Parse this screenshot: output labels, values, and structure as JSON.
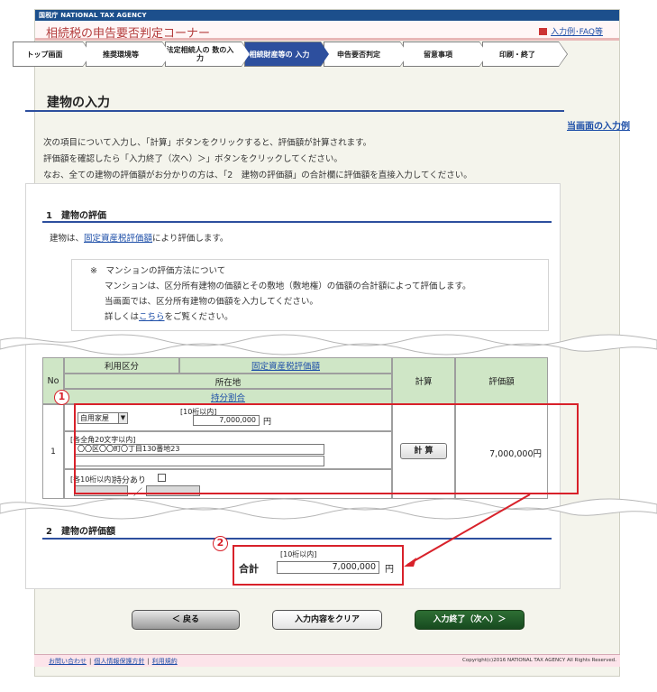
{
  "header": {
    "agency": "国税庁 NATIONAL TAX AGENCY",
    "app_title": "相続税の申告要否判定コーナー",
    "faq_link": "入力例･FAQ等"
  },
  "steps": [
    {
      "label": "トップ画面",
      "active": false
    },
    {
      "label": "推奨環境等",
      "active": false
    },
    {
      "label": "法定相続人の 数の入力",
      "active": false
    },
    {
      "label": "相続財産等の 入力",
      "active": true
    },
    {
      "label": "申告要否判定",
      "active": false
    },
    {
      "label": "留意事項",
      "active": false
    },
    {
      "label": "印刷・終了",
      "active": false
    }
  ],
  "page": {
    "heading": "建物の入力",
    "example_link": "当画面の入力例",
    "intro": [
      "次の項目について入力し、「計算」ボタンをクリックすると、評価額が計算されます。",
      "評価額を確認したら「入力終了（次へ）＞」ボタンをクリックしてください。",
      "なお、全ての建物の評価額がお分かりの方は、「2　建物の評価額」の合計欄に評価額を直接入力してください。"
    ]
  },
  "section1": {
    "title": "1　建物の評価",
    "text_prefix": "建物は、",
    "text_link": "固定資産税評価額",
    "text_suffix": "により評価します。",
    "note": {
      "mark": "※",
      "title": "マンションの評価方法について",
      "line1": "マンションは、区分所有建物の価額とその敷地（敷地権）の価額の合計額によって評価します。",
      "line2": "当画面では、区分所有建物の価額を入力してください。",
      "line3_prefix": "詳しくは",
      "line3_link": "こちら",
      "line3_suffix": "をご覧ください。"
    }
  },
  "table": {
    "col_no": "No",
    "col_usage": "利用区分",
    "col_value_link": "固定資産税評価額",
    "col_location": "所在地",
    "col_share_link": "持分割合",
    "col_calc": "計算",
    "col_amount": "評価額",
    "row": {
      "no": "1",
      "usage_value": "自用家屋",
      "value_hint": "[10桁以内]",
      "value": "7,000,000",
      "value_unit": "円",
      "location_hint": "[各全角20文字以内]",
      "location_line1": "〇〇区〇〇町〇丁目130番地23",
      "location_line2": "",
      "share_hint": "[各10桁以内]",
      "share_label": "持分あり",
      "share_slash": "／",
      "calc_button": "計 算",
      "amount": "7,000,000円"
    }
  },
  "section2": {
    "title": "2　建物の評価額",
    "total_hint": "[10桁以内]",
    "total_label": "合計",
    "total_value": "7,000,000",
    "total_unit": "円"
  },
  "annotations": {
    "badge1": "1",
    "badge2": "2"
  },
  "buttons": {
    "back": "＜ 戻る",
    "clear": "入力内容をクリア",
    "next": "入力終了（次へ）＞"
  },
  "footer": {
    "link1": "お問い合わせ",
    "link2": "個人情報保護方針",
    "link3": "利用規約",
    "copyright": "Copyright(c)2016 NATIONAL TAX AGENCY All Rights Reserved."
  },
  "colors": {
    "accent": "#2d4f9e",
    "header_bar": "#1c4f8c",
    "table_header": "#cfe6c6",
    "annotation_red": "#d8212a",
    "next_button": "#1f5a28"
  }
}
